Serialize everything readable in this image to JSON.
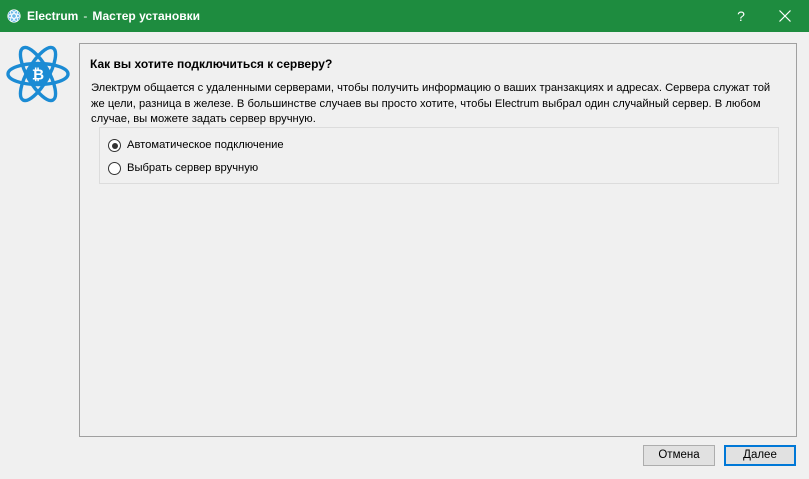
{
  "window": {
    "app_name": "Electrum",
    "separator": "-",
    "title": "Мастер установки",
    "help_label": "?",
    "icons": {
      "app": "electrum-icon",
      "close": "close-icon",
      "logo": "electrum-logo-icon"
    },
    "colors": {
      "titlebar": "#1e8c3f",
      "logo": "#1b8bd4",
      "primary_button_border": "#0078d7"
    }
  },
  "wizard": {
    "question": "Как вы хотите подключиться к серверу?",
    "description": "Электрум общается с удаленными серверами, чтобы получить информацию о ваших транзакциях и адресах.  Сервера служат той же цели, разница в железе. В большинстве случаев вы просто хотите, чтобы Electrum выбрал один случайный сервер. В любом случае, вы можете задать сервер вручную.",
    "options": [
      {
        "label": "Автоматическое подключение",
        "checked": true
      },
      {
        "label": "Выбрать сервер вручную",
        "checked": false
      }
    ]
  },
  "buttons": {
    "cancel": "Отмена",
    "next": "Далее"
  }
}
